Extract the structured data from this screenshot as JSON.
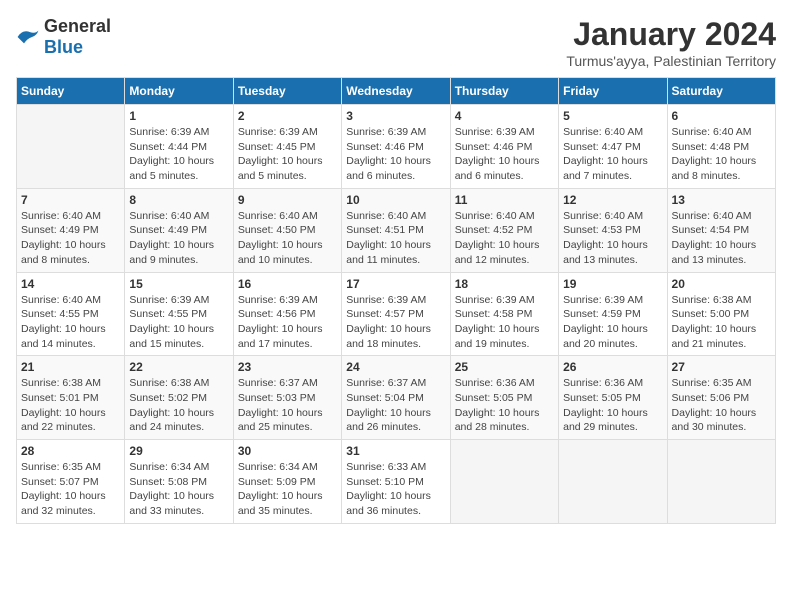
{
  "logo": {
    "general": "General",
    "blue": "Blue"
  },
  "title": "January 2024",
  "subtitle": "Turmus'ayya, Palestinian Territory",
  "days_header": [
    "Sunday",
    "Monday",
    "Tuesday",
    "Wednesday",
    "Thursday",
    "Friday",
    "Saturday"
  ],
  "weeks": [
    [
      {
        "num": "",
        "info": ""
      },
      {
        "num": "1",
        "info": "Sunrise: 6:39 AM\nSunset: 4:44 PM\nDaylight: 10 hours\nand 5 minutes."
      },
      {
        "num": "2",
        "info": "Sunrise: 6:39 AM\nSunset: 4:45 PM\nDaylight: 10 hours\nand 5 minutes."
      },
      {
        "num": "3",
        "info": "Sunrise: 6:39 AM\nSunset: 4:46 PM\nDaylight: 10 hours\nand 6 minutes."
      },
      {
        "num": "4",
        "info": "Sunrise: 6:39 AM\nSunset: 4:46 PM\nDaylight: 10 hours\nand 6 minutes."
      },
      {
        "num": "5",
        "info": "Sunrise: 6:40 AM\nSunset: 4:47 PM\nDaylight: 10 hours\nand 7 minutes."
      },
      {
        "num": "6",
        "info": "Sunrise: 6:40 AM\nSunset: 4:48 PM\nDaylight: 10 hours\nand 8 minutes."
      }
    ],
    [
      {
        "num": "7",
        "info": "Sunrise: 6:40 AM\nSunset: 4:49 PM\nDaylight: 10 hours\nand 8 minutes."
      },
      {
        "num": "8",
        "info": "Sunrise: 6:40 AM\nSunset: 4:49 PM\nDaylight: 10 hours\nand 9 minutes."
      },
      {
        "num": "9",
        "info": "Sunrise: 6:40 AM\nSunset: 4:50 PM\nDaylight: 10 hours\nand 10 minutes."
      },
      {
        "num": "10",
        "info": "Sunrise: 6:40 AM\nSunset: 4:51 PM\nDaylight: 10 hours\nand 11 minutes."
      },
      {
        "num": "11",
        "info": "Sunrise: 6:40 AM\nSunset: 4:52 PM\nDaylight: 10 hours\nand 12 minutes."
      },
      {
        "num": "12",
        "info": "Sunrise: 6:40 AM\nSunset: 4:53 PM\nDaylight: 10 hours\nand 13 minutes."
      },
      {
        "num": "13",
        "info": "Sunrise: 6:40 AM\nSunset: 4:54 PM\nDaylight: 10 hours\nand 13 minutes."
      }
    ],
    [
      {
        "num": "14",
        "info": "Sunrise: 6:40 AM\nSunset: 4:55 PM\nDaylight: 10 hours\nand 14 minutes."
      },
      {
        "num": "15",
        "info": "Sunrise: 6:39 AM\nSunset: 4:55 PM\nDaylight: 10 hours\nand 15 minutes."
      },
      {
        "num": "16",
        "info": "Sunrise: 6:39 AM\nSunset: 4:56 PM\nDaylight: 10 hours\nand 17 minutes."
      },
      {
        "num": "17",
        "info": "Sunrise: 6:39 AM\nSunset: 4:57 PM\nDaylight: 10 hours\nand 18 minutes."
      },
      {
        "num": "18",
        "info": "Sunrise: 6:39 AM\nSunset: 4:58 PM\nDaylight: 10 hours\nand 19 minutes."
      },
      {
        "num": "19",
        "info": "Sunrise: 6:39 AM\nSunset: 4:59 PM\nDaylight: 10 hours\nand 20 minutes."
      },
      {
        "num": "20",
        "info": "Sunrise: 6:38 AM\nSunset: 5:00 PM\nDaylight: 10 hours\nand 21 minutes."
      }
    ],
    [
      {
        "num": "21",
        "info": "Sunrise: 6:38 AM\nSunset: 5:01 PM\nDaylight: 10 hours\nand 22 minutes."
      },
      {
        "num": "22",
        "info": "Sunrise: 6:38 AM\nSunset: 5:02 PM\nDaylight: 10 hours\nand 24 minutes."
      },
      {
        "num": "23",
        "info": "Sunrise: 6:37 AM\nSunset: 5:03 PM\nDaylight: 10 hours\nand 25 minutes."
      },
      {
        "num": "24",
        "info": "Sunrise: 6:37 AM\nSunset: 5:04 PM\nDaylight: 10 hours\nand 26 minutes."
      },
      {
        "num": "25",
        "info": "Sunrise: 6:36 AM\nSunset: 5:05 PM\nDaylight: 10 hours\nand 28 minutes."
      },
      {
        "num": "26",
        "info": "Sunrise: 6:36 AM\nSunset: 5:05 PM\nDaylight: 10 hours\nand 29 minutes."
      },
      {
        "num": "27",
        "info": "Sunrise: 6:35 AM\nSunset: 5:06 PM\nDaylight: 10 hours\nand 30 minutes."
      }
    ],
    [
      {
        "num": "28",
        "info": "Sunrise: 6:35 AM\nSunset: 5:07 PM\nDaylight: 10 hours\nand 32 minutes."
      },
      {
        "num": "29",
        "info": "Sunrise: 6:34 AM\nSunset: 5:08 PM\nDaylight: 10 hours\nand 33 minutes."
      },
      {
        "num": "30",
        "info": "Sunrise: 6:34 AM\nSunset: 5:09 PM\nDaylight: 10 hours\nand 35 minutes."
      },
      {
        "num": "31",
        "info": "Sunrise: 6:33 AM\nSunset: 5:10 PM\nDaylight: 10 hours\nand 36 minutes."
      },
      {
        "num": "",
        "info": ""
      },
      {
        "num": "",
        "info": ""
      },
      {
        "num": "",
        "info": ""
      }
    ]
  ]
}
